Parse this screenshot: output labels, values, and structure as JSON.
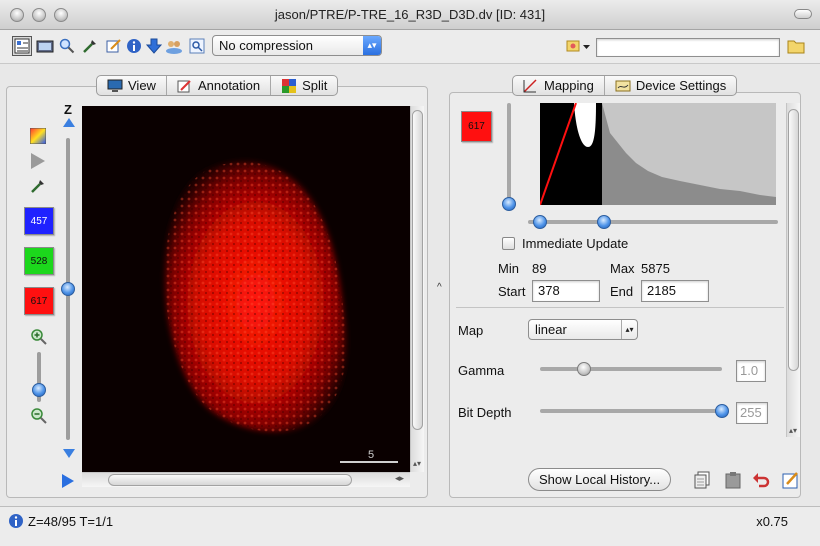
{
  "window": {
    "title": "jason/PTRE/P-TRE_16_R3D_D3D.dv [ID: 431]"
  },
  "toolbar": {
    "compression": "No compression",
    "search_value": "",
    "icons": [
      "render-mode-icon",
      "movie-icon",
      "zoom-icon",
      "pipette-icon",
      "edit-icon",
      "info-icon",
      "download-icon",
      "users-icon",
      "find-icon"
    ]
  },
  "viewer": {
    "tabs": [
      {
        "label": "View"
      },
      {
        "label": "Annotation"
      },
      {
        "label": "Split"
      }
    ],
    "z_label": "Z",
    "channels": [
      {
        "label": "457",
        "color": "#1f22ff"
      },
      {
        "label": "528",
        "color": "#1cd71c"
      },
      {
        "label": "617",
        "color": "#ff1010"
      }
    ],
    "z_level_fraction": 0.5,
    "scale_bar_label": "5"
  },
  "settings": {
    "tabs": [
      {
        "label": "Mapping"
      },
      {
        "label": "Device Settings"
      }
    ],
    "channel_label": "617",
    "channel_color": "#ff1010",
    "immediate_update_label": "Immediate Update",
    "immediate_update_checked": false,
    "min_label": "Min",
    "min_value": "89",
    "max_label": "Max",
    "max_value": "5875",
    "start_label": "Start",
    "start_value": "378",
    "end_label": "End",
    "end_value": "2185",
    "map_label": "Map",
    "map_value": "linear",
    "gamma_label": "Gamma",
    "gamma_value": "1.0",
    "gamma_fraction": 0.24,
    "bitdepth_label": "Bit Depth",
    "bitdepth_value": "255",
    "bitdepth_fraction": 1.0
  },
  "actions": {
    "history_label": "Show Local History..."
  },
  "status": {
    "left": "Z=48/95 T=1/1",
    "right": "x0.75"
  }
}
